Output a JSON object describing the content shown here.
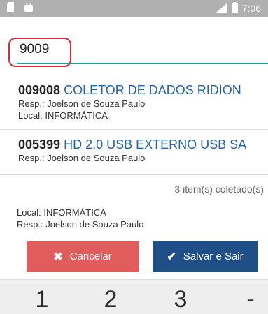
{
  "status_bar": {
    "left_icons": [
      "sd-card-icon",
      "android-icon"
    ],
    "time": "7:06"
  },
  "search": {
    "value": "9009",
    "highlight_color": "#e0283b",
    "underline_color": "#1ba38f"
  },
  "items": [
    {
      "code": "009008",
      "name": "COLETOR DE DADOS RIDION",
      "resp_label": "Resp.:",
      "resp_value": "Joelson de Souza Paulo",
      "local_label": "Local:",
      "local_value": "INFORMÁTICA"
    },
    {
      "code": "005399",
      "name": "HD 2.0 USB EXTERNO USB SA",
      "resp_label": "Resp.:",
      "resp_value": "Joelson de Souza Paulo"
    }
  ],
  "count_text": "3 item(s) coletado(s)",
  "footer": {
    "local_label": "Local:",
    "local_value": "INFORMÁTICA",
    "resp_label": "Resp.:",
    "resp_value": "Joelson de Souza Paulo"
  },
  "buttons": {
    "cancel": "Cancelar",
    "save": "Salvar e Sair",
    "cancel_color": "#e15c5c",
    "save_color": "#1f4f86"
  },
  "keyboard": {
    "keys": [
      "1",
      "2",
      "3",
      "-"
    ]
  }
}
